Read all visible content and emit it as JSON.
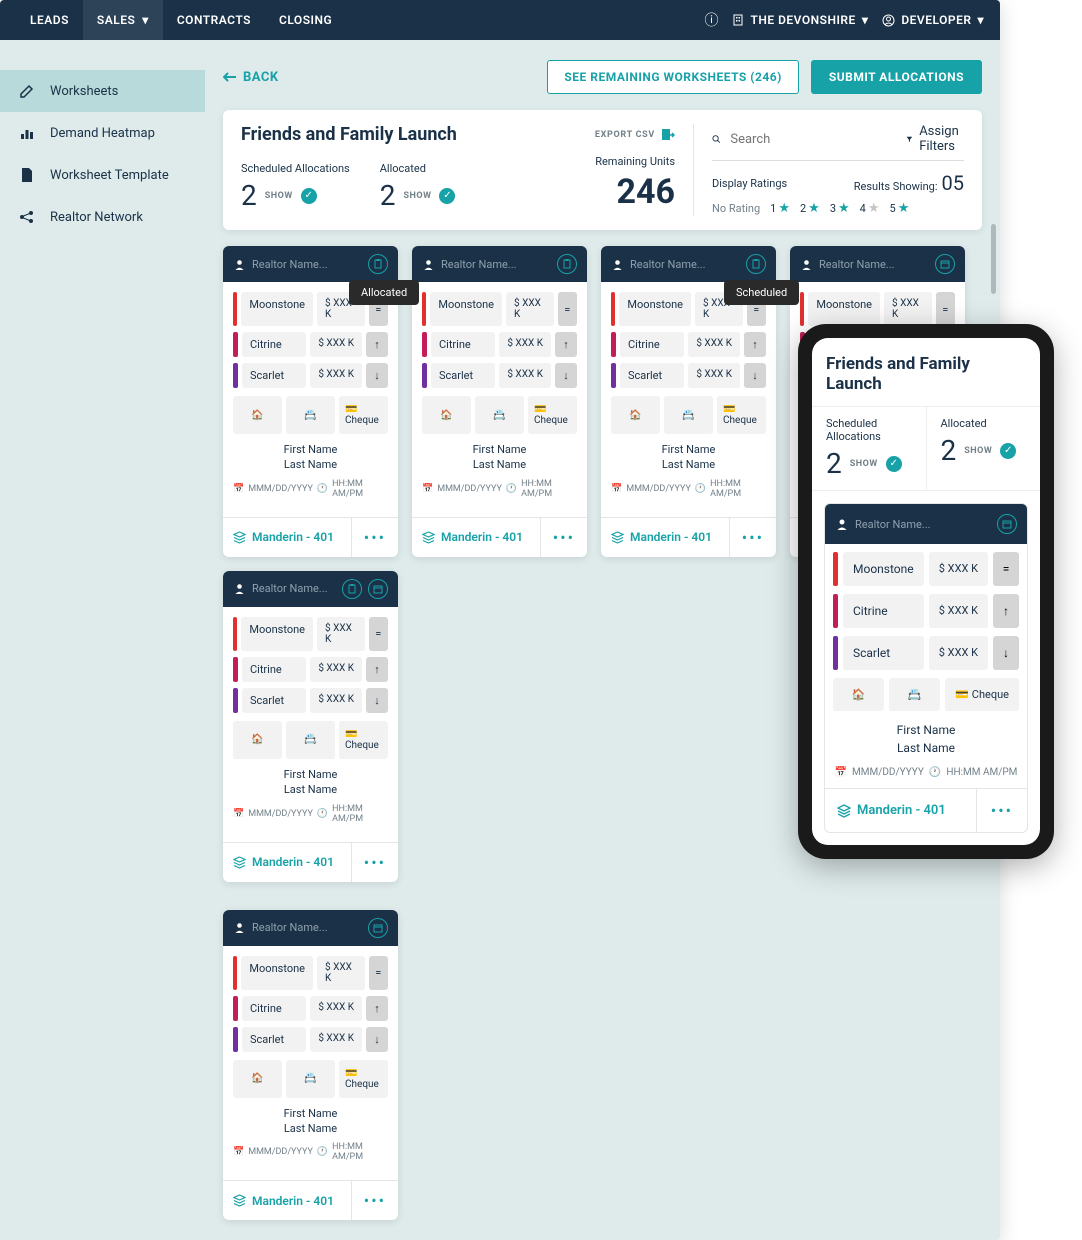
{
  "nav": {
    "items": [
      "LEADS",
      "SALES",
      "CONTRACTS",
      "CLOSING"
    ],
    "building": "THE DEVONSHIRE",
    "user": "DEVELOPER"
  },
  "sidebar": [
    {
      "label": "Worksheets"
    },
    {
      "label": "Demand Heatmap"
    },
    {
      "label": "Worksheet Template"
    },
    {
      "label": "Realtor Network"
    }
  ],
  "back": "BACK",
  "btn_remaining": "SEE REMAINING WORKSHEETS (246)",
  "btn_submit": "SUBMIT ALLOCATIONS",
  "title": "Friends and Family Launch",
  "export": "EXPORT CSV",
  "stats": {
    "sched_label": "Scheduled Allocations",
    "sched": "2",
    "alloc_label": "Allocated",
    "alloc": "2",
    "show": "SHOW",
    "remain_label": "Remaining Units",
    "remain": "246"
  },
  "search": {
    "placeholder": "Search",
    "assign": "Assign Filters",
    "display": "Display Ratings",
    "results": "Results Showing:",
    "results_num": "05",
    "norating": "No Rating"
  },
  "tooltips": {
    "allocated": "Allocated",
    "scheduled": "Scheduled"
  },
  "card": {
    "realtor": "Realtor Name...",
    "units": [
      {
        "name": "Moonstone",
        "price": "$ XXX K",
        "icon": "="
      },
      {
        "name": "Citrine",
        "price": "$ XXX K",
        "icon": "↑"
      },
      {
        "name": "Scarlet",
        "price": "$ XXX K",
        "icon": "↓"
      }
    ],
    "cheque": "Cheque",
    "first": "First Name",
    "last": "Last Name",
    "date": "MMM/DD/YYYY",
    "time": "HH:MM AM/PM",
    "foot": "Manderin - 401"
  }
}
